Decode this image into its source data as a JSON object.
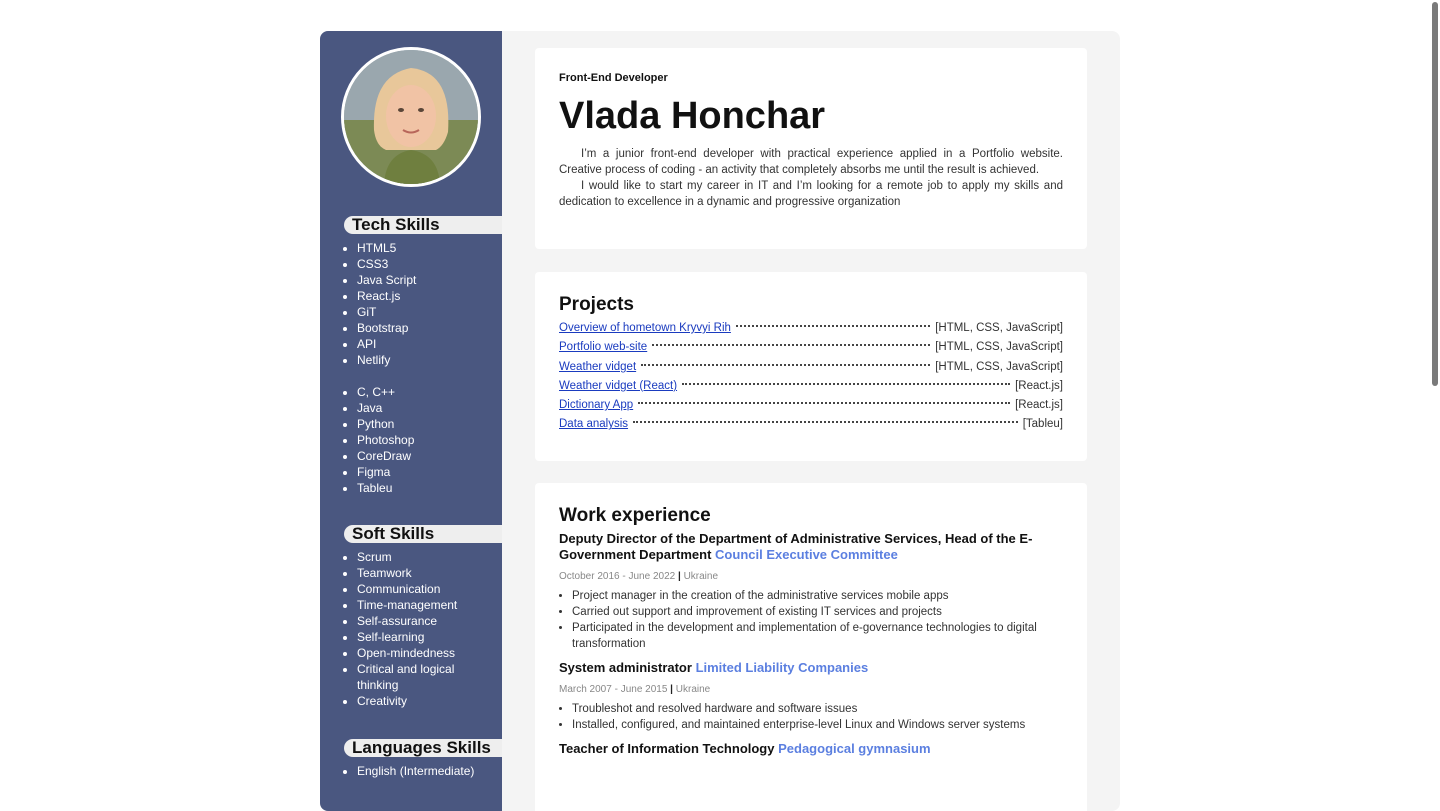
{
  "profile": {
    "role": "Front-End Developer",
    "name": "Vlada Honchar",
    "about": [
      "I’m a junior front-end developer with practical experience applied in a Portfolio website. Creative process of coding - an activity that completely absorbs me until the result is achieved.",
      "I would like to start my career in IT and I’m looking for a remote job to apply my skills and dedication to excellence in a dynamic and progressive organization"
    ]
  },
  "sidebar": {
    "tech_skills": {
      "heading": "Tech Skills",
      "group1": [
        "HTML5",
        "CSS3",
        "Java Script",
        "React.js",
        "GiT",
        "Bootstrap",
        "API",
        "Netlify"
      ],
      "group2": [
        "C, C++",
        "Java",
        "Python",
        "Photoshop",
        "CoreDraw",
        "Figma",
        "Tableu"
      ]
    },
    "soft_skills": {
      "heading": "Soft Skills",
      "items": [
        "Scrum",
        "Teamwork",
        "Communication",
        "Time-management",
        "Self-assurance",
        "Self-learning",
        "Open-mindedness",
        "Critical and logical thinking",
        "Creativity"
      ]
    },
    "languages": {
      "heading": "Languages Skills",
      "items": [
        "English (Intermediate)"
      ]
    }
  },
  "projects": {
    "title": "Projects",
    "items": [
      {
        "name": "Overview of hometown Kryvyi Rih",
        "tech": "[HTML, CSS, JavaScript]"
      },
      {
        "name": "Portfolio web-site",
        "tech": "[HTML, CSS, JavaScript]"
      },
      {
        "name": "Weather vidget",
        "tech": "[HTML, CSS, JavaScript]"
      },
      {
        "name": "Weather vidget (React)",
        "tech": "[React.js]"
      },
      {
        "name": "Dictionary App",
        "tech": "[React.js]"
      },
      {
        "name": "Data analysis",
        "tech": "[Tableu]"
      }
    ]
  },
  "work": {
    "title": "Work experience",
    "jobs": [
      {
        "title": "Deputy Director of the Department of Administrative Services, Head of the E-Government Department",
        "company": "Council Executive Committee",
        "period": "October 2016 - June 2022",
        "location": "Ukraine",
        "duties": [
          "Project manager in the creation of the administrative services mobile apps",
          "Carried out support and improvement of existing IT services and projects",
          "Participated in the development and implementation of e-governance technologies to digital transformation"
        ]
      },
      {
        "title": "System administrator",
        "company": "Limited Liability Companies",
        "period": "March 2007 - June 2015",
        "location": "Ukraine",
        "duties": [
          "Troubleshot and resolved hardware and software issues",
          "Installed, configured, and maintained enterprise-level Linux and Windows server systems"
        ]
      },
      {
        "title": "Teacher of Information Technology",
        "company": "Pedagogical gymnasium",
        "period": "",
        "location": "",
        "duties": []
      }
    ]
  },
  "colors": {
    "sidebar_bg": "#4a5780",
    "company_accent": "#5b7fe0",
    "link": "#1a3bbf"
  }
}
